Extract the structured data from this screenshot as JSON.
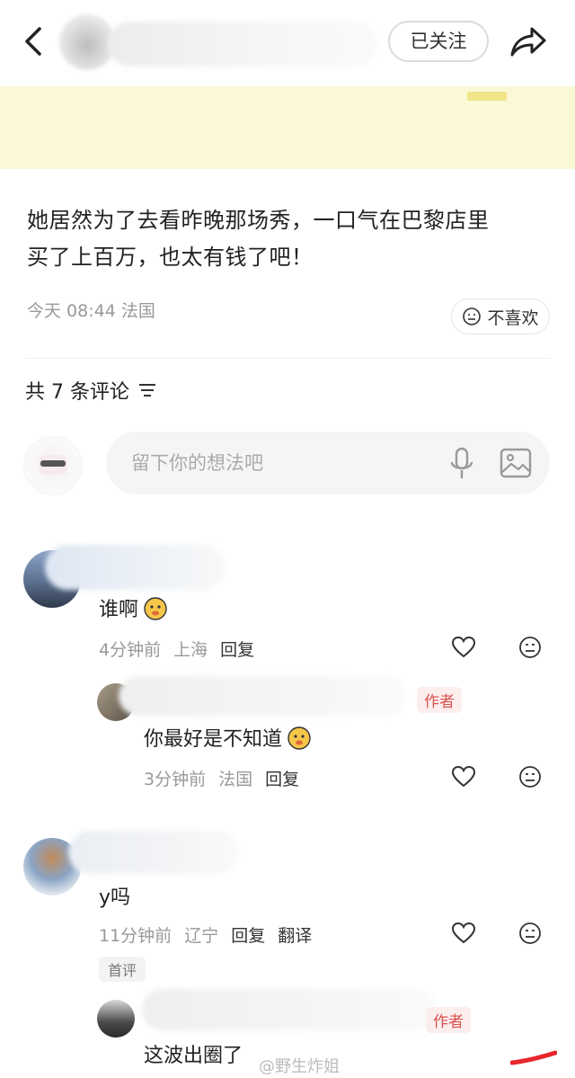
{
  "header": {
    "follow_label": "已关注"
  },
  "post": {
    "text_line1": "她居然为了去看昨晚那场秀，一口气在巴黎店里",
    "text_line2": "买了上百万，也太有钱了吧！",
    "meta": "今天 08:44 法国",
    "dislike_label": "不喜欢"
  },
  "comments_header": {
    "count_label": "共 7 条评论"
  },
  "input": {
    "placeholder": "留下你的想法吧"
  },
  "comments": [
    {
      "text": "谁啊",
      "time": "4分钟前",
      "location": "上海",
      "reply_label": "回复",
      "replies": [
        {
          "badge": "作者",
          "text": "你最好是不知道",
          "time": "3分钟前",
          "location": "法国",
          "reply_label": "回复"
        }
      ]
    },
    {
      "text": "y吗",
      "time": "11分钟前",
      "location": "辽宁",
      "reply_label": "回复",
      "translate_label": "翻译",
      "badge": "首评",
      "replies": [
        {
          "badge": "作者",
          "text": "这波出圈了"
        }
      ]
    }
  ],
  "watermark": "@野生炸姐",
  "colors": {
    "banner": "#fbf8d6",
    "author_badge": "#d9534f",
    "accent_red": "#e8262c"
  }
}
